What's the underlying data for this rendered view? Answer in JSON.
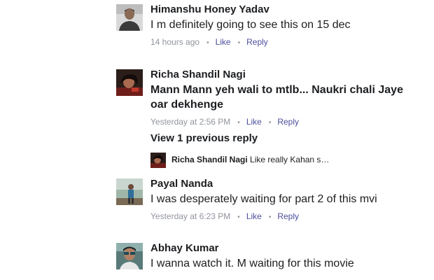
{
  "comments": [
    {
      "author": "Himanshu Honey Yadav",
      "text": "I m definitely going to see this on 15 dec",
      "time": "14 hours ago",
      "like_label": "Like",
      "reply_label": "Reply",
      "avatar_icon": "profile-photo-man"
    },
    {
      "author": "Richa Shandil Nagi",
      "text": "Mann Mann yeh wali to mtlb... Naukri chali Jaye oar dekhenge",
      "time": "Yesterday at 2:56 PM",
      "like_label": "Like",
      "reply_label": "Reply",
      "avatar_icon": "profile-photo-woman"
    },
    {
      "author": "Payal Nanda",
      "text": "I was desperately waiting for part 2 of this mvi",
      "time": "Yesterday at 6:23 PM",
      "like_label": "Like",
      "reply_label": "Reply",
      "avatar_icon": "profile-photo-outdoor"
    },
    {
      "author": "Abhay Kumar",
      "text": "I wanna watch it. M waiting for this movie",
      "avatar_icon": "profile-photo-sunglasses"
    }
  ],
  "replies_thread": {
    "view_label": "View 1 previous reply",
    "preview_author": "Richa Shandil Nagi",
    "preview_text": "Like really Kahan se l…"
  },
  "colors": {
    "text": "#1c1e21",
    "meta": "#90949c",
    "link": "#4b4f9c"
  }
}
